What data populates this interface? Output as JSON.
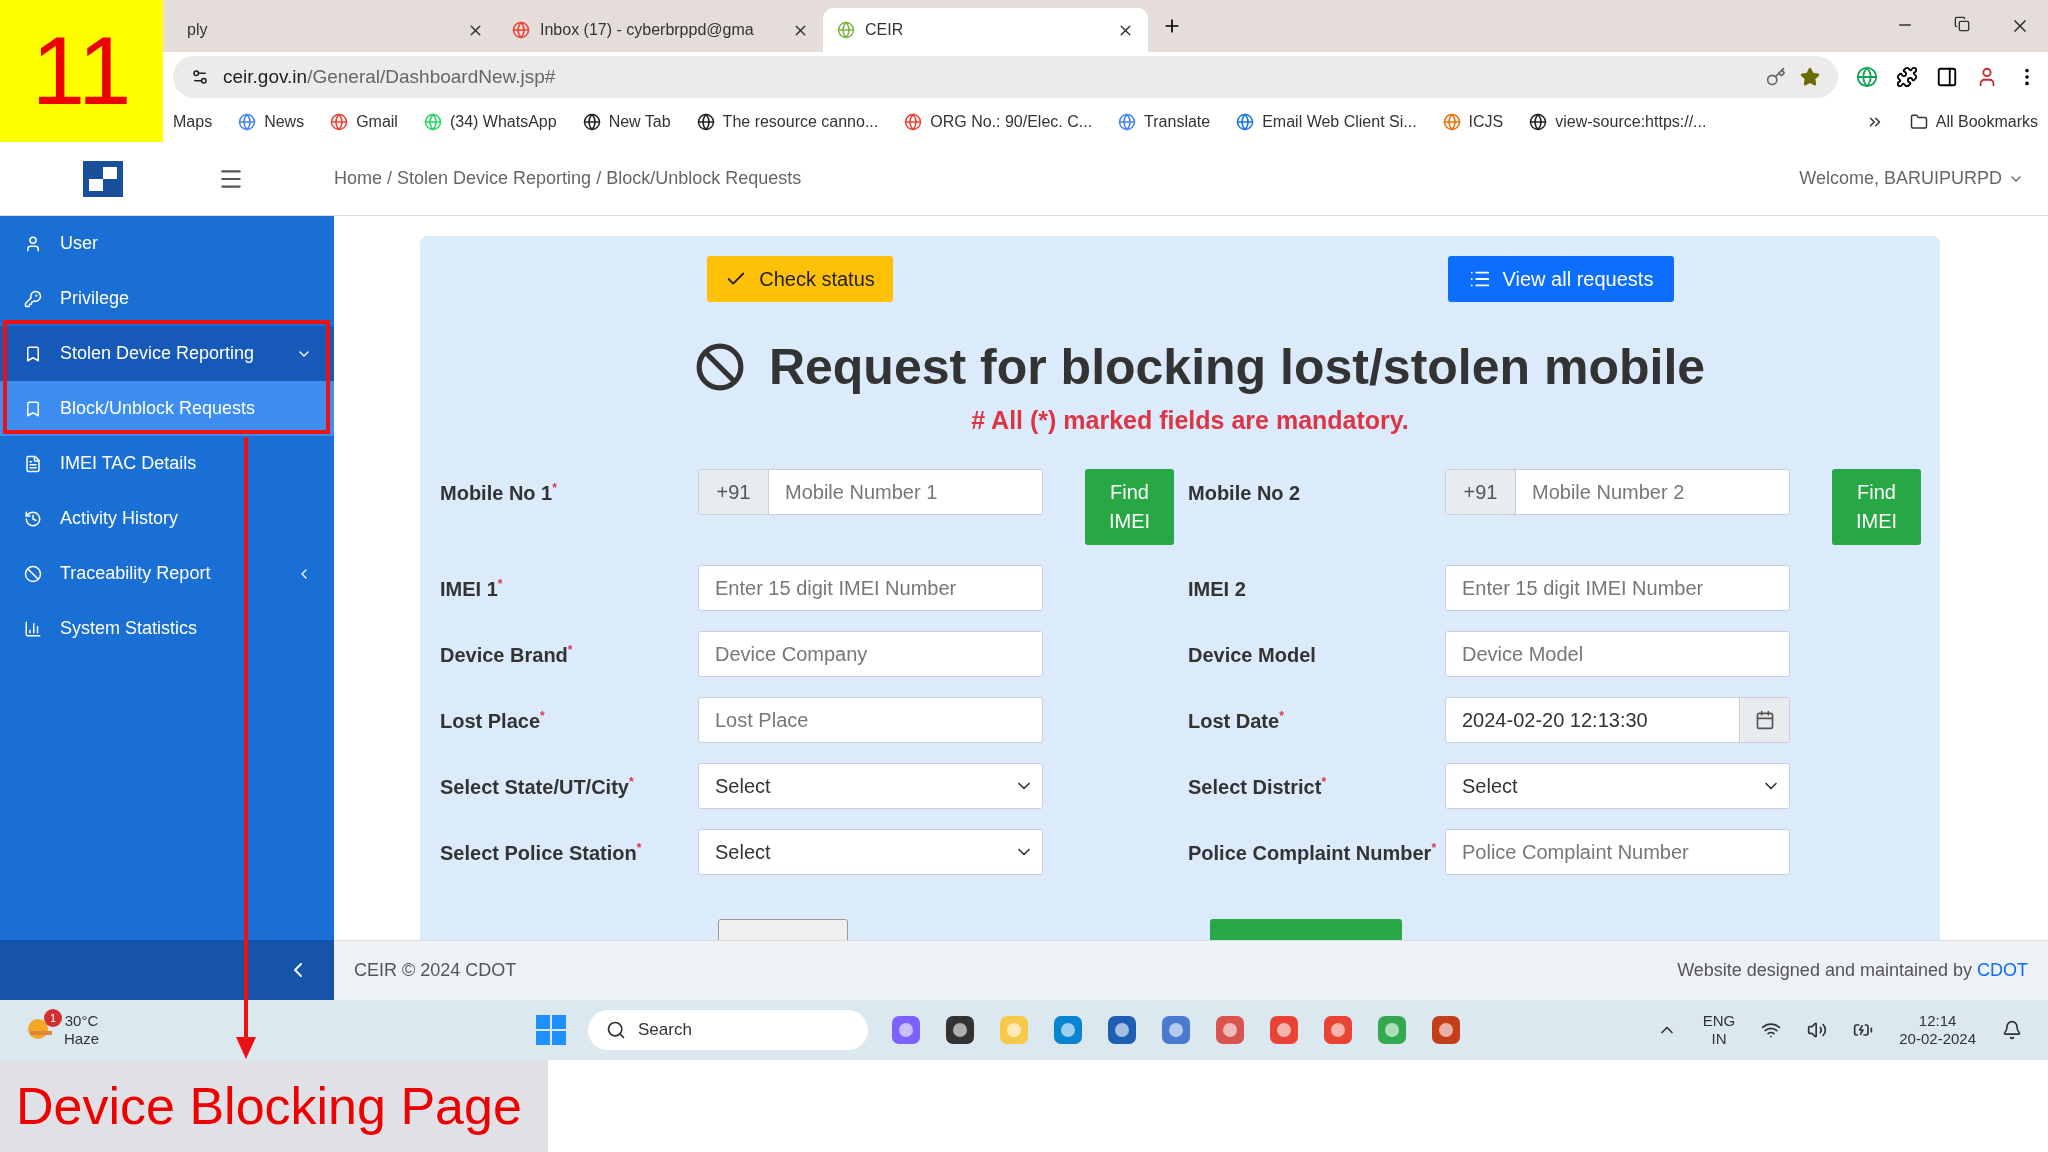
{
  "slide_number": "11",
  "caption": "Device Blocking Page",
  "browser": {
    "tabs": [
      {
        "title": "ply",
        "selected": false
      },
      {
        "title": "Inbox (17) - cyberbrppd@gma",
        "selected": false
      },
      {
        "title": "CEIR",
        "selected": true
      }
    ],
    "url_host": "ceir.gov.in",
    "url_path": "/General/DashboardNew.jsp#",
    "bookmarks": [
      "Maps",
      "News",
      "Gmail",
      "(34) WhatsApp",
      "New Tab",
      "The resource canno...",
      "ORG No.: 90/Elec. C...",
      "Translate",
      "Email Web Client Si...",
      "ICJS",
      "view-source:https://..."
    ],
    "all_bookmarks": "All Bookmarks"
  },
  "header": {
    "breadcrumb": "Home / Stolen Device Reporting / Block/Unblock Requests",
    "welcome": "Welcome, BARUIPURPD"
  },
  "sidebar": {
    "items": [
      {
        "label": "User",
        "submenu": false,
        "expanded": false,
        "selected": false
      },
      {
        "label": "Privilege",
        "submenu": false,
        "expanded": false,
        "selected": false
      },
      {
        "label": "Stolen Device Reporting",
        "submenu": true,
        "expanded": true,
        "selected": false,
        "children": [
          {
            "label": "Block/Unblock Requests",
            "selected": true
          }
        ]
      },
      {
        "label": "IMEI TAC Details",
        "submenu": false,
        "expanded": false,
        "selected": false
      },
      {
        "label": "Activity History",
        "submenu": false,
        "expanded": false,
        "selected": false
      },
      {
        "label": "Traceability Report",
        "submenu": true,
        "expanded": false,
        "selected": false
      },
      {
        "label": "System Statistics",
        "submenu": false,
        "expanded": false,
        "selected": false
      }
    ]
  },
  "form": {
    "check_status": "Check status",
    "view_all": "View all requests",
    "title": "Request for blocking lost/stolen mobile",
    "note": "# All (*) marked fields are mandatory.",
    "required_mark": "*",
    "fields": [
      {
        "kind": "phone",
        "label": "Mobile No 1",
        "required": true,
        "prefix": "+91",
        "placeholder": "Mobile Number 1",
        "button": "Find IMEI"
      },
      {
        "kind": "phone",
        "label": "Mobile No 2",
        "required": false,
        "prefix": "+91",
        "placeholder": "Mobile Number 2",
        "button": "Find IMEI"
      },
      {
        "kind": "text",
        "label": "IMEI 1",
        "required": true,
        "placeholder": "Enter 15 digit IMEI Number"
      },
      {
        "kind": "text",
        "label": "IMEI 2",
        "required": false,
        "placeholder": "Enter 15 digit IMEI Number"
      },
      {
        "kind": "text",
        "label": "Device Brand",
        "required": true,
        "placeholder": "Device Company"
      },
      {
        "kind": "text",
        "label": "Device Model",
        "required": false,
        "placeholder": "Device Model"
      },
      {
        "kind": "text",
        "label": "Lost Place",
        "required": true,
        "placeholder": "Lost Place"
      },
      {
        "kind": "date",
        "label": "Lost Date",
        "required": true,
        "value": "2024-02-20 12:13:30"
      },
      {
        "kind": "select",
        "label": "Select State/UT/City",
        "required": true,
        "value": "Select"
      },
      {
        "kind": "select",
        "label": "Select District",
        "required": true,
        "value": "Select"
      },
      {
        "kind": "select",
        "label": "Select Police Station",
        "required": true,
        "value": "Select"
      },
      {
        "kind": "text",
        "label": "Police Complaint Number",
        "required": true,
        "placeholder": "Police Complaint Number"
      }
    ]
  },
  "footer": {
    "copyright": "CEIR © 2024 CDOT",
    "credit": "Website designed and maintained by ",
    "credit_link": "CDOT"
  },
  "taskbar": {
    "temperature": "30°C",
    "weather": "Haze",
    "weather_badge": "1",
    "search": "Search",
    "language": "ENG",
    "region": "IN",
    "time": "12:14",
    "date": "20-02-2024"
  }
}
